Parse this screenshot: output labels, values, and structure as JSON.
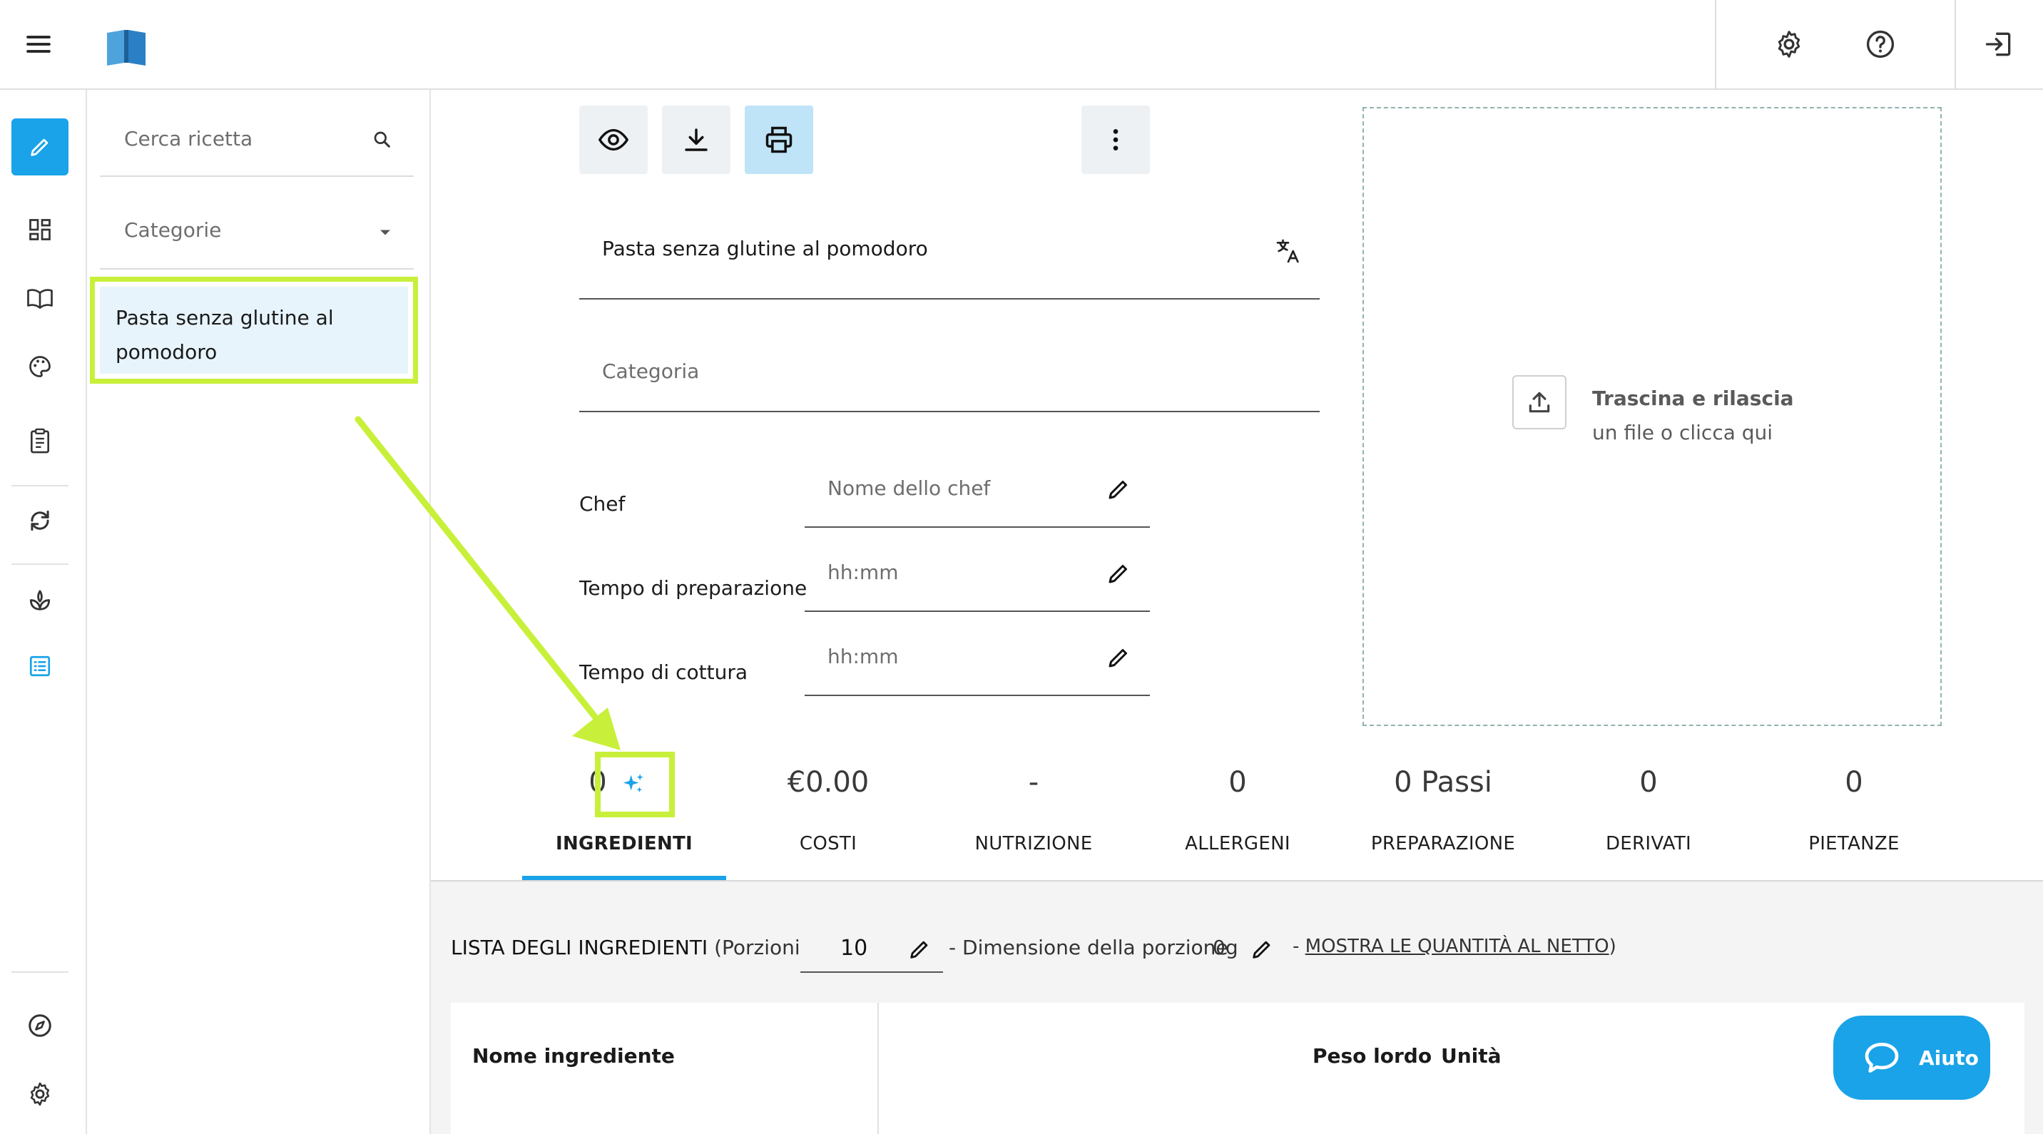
{
  "topbar": {
    "menu_icon": "hamburger-menu-icon",
    "logo_icon": "book-logo-icon",
    "settings_icon": "gear-icon",
    "help_icon": "help-circle-icon",
    "logout_icon": "logout-icon"
  },
  "rail": {
    "items": [
      "pencil-edit-icon",
      "dashboard-icon",
      "book-icon",
      "palette-icon",
      "clipboard-icon",
      "sync-icon",
      "plant-icon",
      "list-icon",
      "compass-icon",
      "gear-icon"
    ],
    "active_color": "#1aa3e8"
  },
  "list": {
    "search_placeholder": "Cerca ricetta",
    "category_placeholder": "Categorie",
    "items": [
      {
        "label": "Pasta senza glutine al pomodoro",
        "selected": true
      }
    ]
  },
  "toolbar": {
    "view_icon": "eye-icon",
    "download_icon": "download-icon",
    "print_icon": "printer-icon",
    "more_icon": "more-vertical-icon"
  },
  "recipe": {
    "name": "Pasta senza glutine al pomodoro",
    "translate_icon": "translate-icon",
    "category_placeholder": "Categoria",
    "fields": [
      {
        "label": "Chef",
        "placeholder": "Nome dello chef"
      },
      {
        "label": "Tempo di preparazione",
        "placeholder": "hh:mm"
      },
      {
        "label": "Tempo di cottura",
        "placeholder": "hh:mm"
      }
    ]
  },
  "upload": {
    "title": "Trascina e rilascia",
    "subtitle": "un file o clicca qui"
  },
  "stats": [
    {
      "value": "0",
      "label": "INGREDIENTI",
      "active": true
    },
    {
      "value": "€0.00",
      "label": "COSTI"
    },
    {
      "value": "-",
      "label": "NUTRIZIONE"
    },
    {
      "value": "0",
      "label": "ALLERGENI"
    },
    {
      "value": "0 Passi",
      "label": "PREPARAZIONE"
    },
    {
      "value": "0",
      "label": "DERIVATI"
    },
    {
      "value": "0",
      "label": "PIETANZE"
    }
  ],
  "ingredients": {
    "title": "LISTA DEGLI INGREDIENTI",
    "portions_prefix": "(Porzioni",
    "portions_value": "10",
    "portion_size_label": "- Dimensione della porzione",
    "portion_size_value": "0g",
    "net_prefix": "-",
    "net_link": "MOSTRA LE QUANTITÀ AL NETTO",
    "net_suffix": ")",
    "col_name": "Nome ingrediente",
    "col_gross": "Peso lordo",
    "col_unit": "Unità"
  },
  "help_button": {
    "label": "Aiuto"
  },
  "colors": {
    "accent": "#1aa3e8",
    "highlight": "#c8f03a",
    "selected_bg": "#e7f4fb",
    "tool_bg": "#eef1f4",
    "print_bg": "#bfe3f7"
  }
}
